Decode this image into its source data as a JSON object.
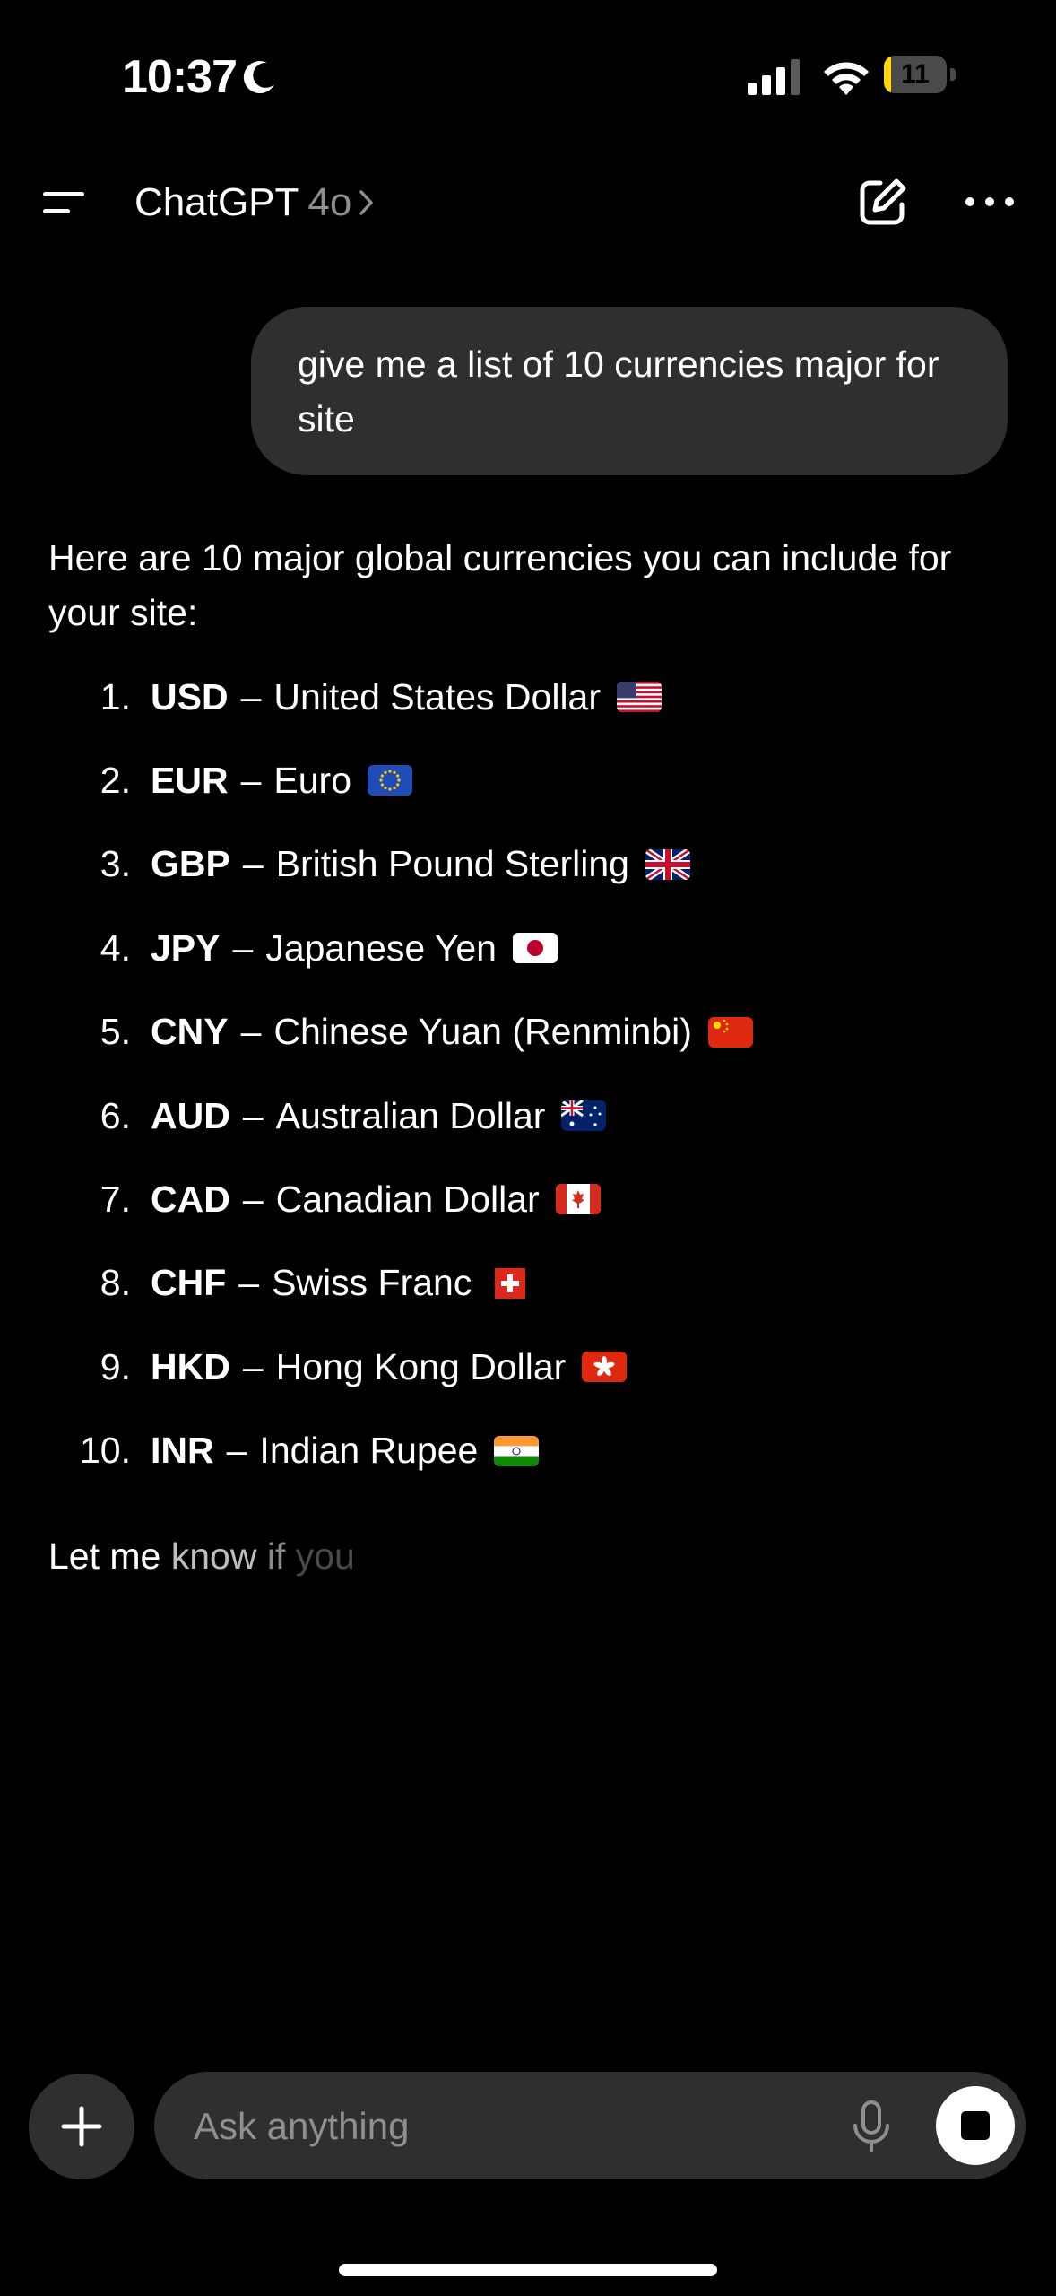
{
  "status_bar": {
    "time": "10:37",
    "battery_level": "11",
    "battery_fraction": 0.11,
    "icons": [
      "moon-icon",
      "cellular-signal-icon",
      "wifi-icon",
      "battery-icon"
    ]
  },
  "header": {
    "title": "ChatGPT",
    "model": "4o",
    "icons": [
      "menu-icon",
      "chevron-right-icon",
      "compose-icon",
      "more-icon"
    ]
  },
  "conversation": {
    "user_message": "give me a list of 10 currencies major for site",
    "assistant": {
      "intro": "Here are 10 major global currencies you can include for your site:",
      "items": [
        {
          "num": "1.",
          "code": "USD",
          "name": "United States Dollar",
          "flag": "us-flag-icon"
        },
        {
          "num": "2.",
          "code": "EUR",
          "name": "Euro",
          "flag": "eu-flag-icon"
        },
        {
          "num": "3.",
          "code": "GBP",
          "name": "British Pound Sterling",
          "flag": "uk-flag-icon"
        },
        {
          "num": "4.",
          "code": "JPY",
          "name": "Japanese Yen",
          "flag": "japan-flag-icon"
        },
        {
          "num": "5.",
          "code": "CNY",
          "name": "Chinese Yuan (Renminbi)",
          "flag": "china-flag-icon"
        },
        {
          "num": "6.",
          "code": "AUD",
          "name": "Australian Dollar",
          "flag": "australia-flag-icon"
        },
        {
          "num": "7.",
          "code": "CAD",
          "name": "Canadian Dollar",
          "flag": "canada-flag-icon"
        },
        {
          "num": "8.",
          "code": "CHF",
          "name": "Swiss Franc",
          "flag": "switzerland-flag-icon"
        },
        {
          "num": "9.",
          "code": "HKD",
          "name": "Hong Kong Dollar",
          "flag": "hong-kong-flag-icon"
        },
        {
          "num": "10.",
          "code": "INR",
          "name": "Indian Rupee",
          "flag": "india-flag-icon"
        }
      ],
      "streaming_text": {
        "part1": "Let me ",
        "part2": "know ",
        "part3": "if ",
        "part4": "you"
      }
    }
  },
  "composer": {
    "placeholder": "Ask anything",
    "icons": [
      "plus-icon",
      "microphone-icon",
      "stop-icon"
    ]
  },
  "colors": {
    "background": "#000000",
    "bubble": "#2f2f2f",
    "text": "#ffffff",
    "muted": "#8e8e93",
    "battery": "#ffd60a"
  }
}
